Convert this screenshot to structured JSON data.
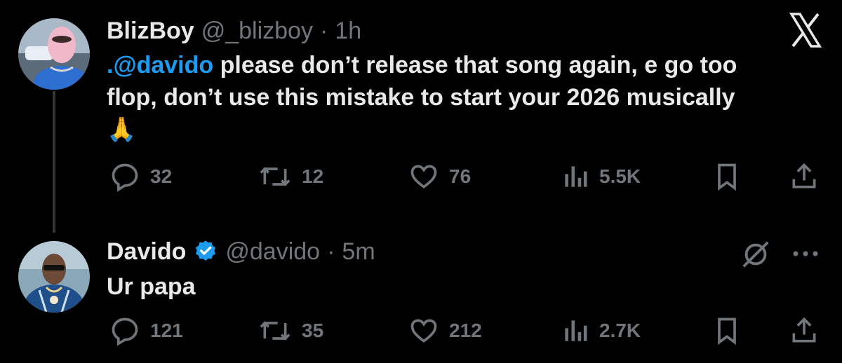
{
  "tweet1": {
    "display_name": "BlizBoy",
    "handle": "@_blizboy",
    "separator": "·",
    "time": "1h",
    "mention": ".@davido",
    "text_line1": " please don’t release that song again, e go too",
    "text_line2": "flop, don’t use this mistake to start your 2026 musically",
    "emoji": "🙏",
    "stats": {
      "replies": "32",
      "reposts": "12",
      "likes": "76",
      "views": "5.5K"
    }
  },
  "tweet2": {
    "display_name": "Davido",
    "handle": "@davido",
    "separator": "·",
    "time": "5m",
    "text": "Ur papa",
    "stats": {
      "replies": "121",
      "reposts": "35",
      "likes": "212",
      "views": "2.7K"
    }
  },
  "colors": {
    "background": "#000000",
    "text": "#e7e9ea",
    "muted": "#71767b",
    "accent": "#1d9bf0",
    "verified": "#1d9bf0"
  },
  "icons": [
    "x-logo-icon",
    "reply-icon",
    "repost-icon",
    "like-icon",
    "views-icon",
    "bookmark-icon",
    "share-icon",
    "grok-icon",
    "more-icon",
    "verified-badge-icon"
  ]
}
